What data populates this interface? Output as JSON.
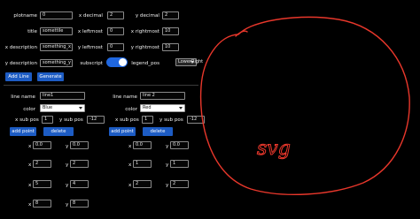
{
  "top": {
    "plotname": {
      "label": "plotname",
      "value": "0"
    },
    "title": {
      "label": "title",
      "value": "somettile"
    },
    "x_description": {
      "label": "x description",
      "value": "something_x"
    },
    "y_description": {
      "label": "y description",
      "value": "something_y"
    },
    "x_decimal": {
      "label": "x decimal",
      "value": "2"
    },
    "x_leftmost": {
      "label": "x leftmost",
      "value": "0"
    },
    "y_leftmost": {
      "label": "y leftmost",
      "value": "0"
    },
    "subscript": {
      "label": "subscript",
      "on": true
    },
    "y_decimal": {
      "label": "y decimal",
      "value": "2"
    },
    "x_rightmost": {
      "label": "x rightmost",
      "value": "10"
    },
    "y_rightmost": {
      "label": "y rightmost",
      "value": "10"
    },
    "legend_pos": {
      "label": "legend_pos",
      "value": "LowerRight"
    },
    "add_line": "Add Line",
    "generate": "Generate"
  },
  "lines": [
    {
      "name_label": "line name",
      "name": "line1",
      "color_label": "color",
      "color": "Blue",
      "xsub_label": "x sub pos",
      "xsub": "1",
      "ysub_label": "y sub pos",
      "ysub": "-12",
      "add_point": "add point",
      "delete": "delete",
      "points": [
        {
          "x_label": "x",
          "x": "0.0",
          "y_label": "y",
          "y": "0.0"
        },
        {
          "x_label": "x",
          "x": "2",
          "y_label": "y",
          "y": "2"
        },
        {
          "x_label": "x",
          "x": "5",
          "y_label": "y",
          "y": "4"
        },
        {
          "x_label": "x",
          "x": "8",
          "y_label": "y",
          "y": "8"
        }
      ]
    },
    {
      "name_label": "line name",
      "name": "line 2",
      "color_label": "color",
      "color": "Red",
      "xsub_label": "x sub pos",
      "xsub": "1",
      "ysub_label": "y sub pos",
      "ysub": "-12",
      "add_point": "add point",
      "delete": "delete",
      "points": [
        {
          "x_label": "x",
          "x": "0.0",
          "y_label": "y",
          "y": "0.0"
        },
        {
          "x_label": "x",
          "x": "1",
          "y_label": "y",
          "y": "1"
        },
        {
          "x_label": "x",
          "x": "2",
          "y_label": "y",
          "y": "2"
        }
      ]
    }
  ],
  "canvas": {
    "annotation": "svg",
    "stroke_color": "#e8372b"
  }
}
